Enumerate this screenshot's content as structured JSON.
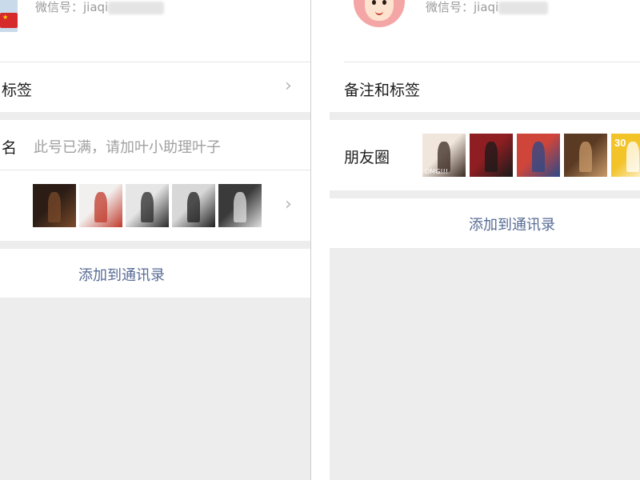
{
  "left": {
    "wechat_id": "微信号：jiaqi",
    "tags_label": "标签",
    "signature_label": "名",
    "signature_value": "此号已满，请加叶小助理叶子",
    "moments_thumbs": [
      {
        "icon": "photo-poster",
        "colors": [
          "#2b1d16",
          "#7a4a2a"
        ],
        "caption": ""
      },
      {
        "icon": "photo-lipsticks",
        "colors": [
          "#f2f0ee",
          "#c0392b"
        ],
        "caption": ""
      },
      {
        "icon": "photo-man-suit",
        "colors": [
          "#e6e6e6",
          "#2a2a2a"
        ],
        "caption": ""
      },
      {
        "icon": "photo-man-tuxedo",
        "colors": [
          "#d8d8d8",
          "#1f1f1f"
        ],
        "caption": ""
      },
      {
        "icon": "photo-man-suit-dark",
        "colors": [
          "#3a3a3a",
          "#e0e0e0"
        ],
        "caption": ""
      }
    ],
    "add_contact": "添加到通讯录"
  },
  "right": {
    "wechat_id": "微信号：jiaqi",
    "remark_label": "备注和标签",
    "moments_label": "朋友圈",
    "moments_thumbs": [
      {
        "icon": "photo-group",
        "colors": [
          "#f0e6dc",
          "#3b2a22"
        ],
        "caption": "OMG!!!"
      },
      {
        "icon": "photo-stage-red",
        "colors": [
          "#8e1e22",
          "#1a1a1a"
        ],
        "caption": ""
      },
      {
        "icon": "photo-crowd",
        "colors": [
          "#d0453a",
          "#2a4a8a"
        ],
        "caption": ""
      },
      {
        "icon": "photo-portrait",
        "colors": [
          "#5a3a22",
          "#c89a6a"
        ],
        "caption": ""
      },
      {
        "icon": "photo-yellow-poster",
        "colors": [
          "#f3c32a",
          "#ffffff"
        ],
        "caption": "",
        "badge": "30"
      }
    ],
    "add_contact": "添加到通讯录"
  },
  "colors": {
    "link": "#576b95",
    "background": "#ededed",
    "card": "#ffffff",
    "muted": "#9a9a9a"
  }
}
